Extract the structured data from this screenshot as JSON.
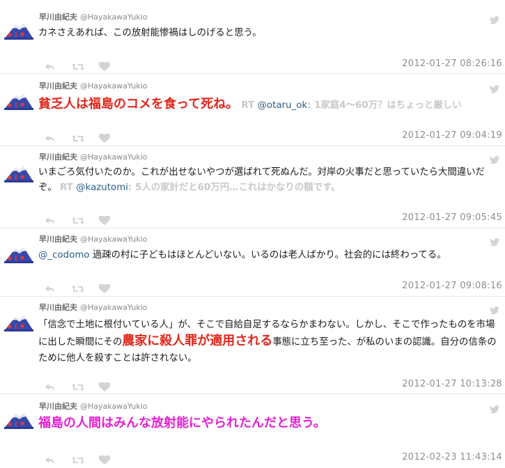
{
  "colors": {
    "highlight_red": "#e0261a",
    "highlight_magenta": "#e51fd3",
    "mention_blue": "#2a5e86",
    "timestamp_gray": "#8e8e8e"
  },
  "tweets": [
    {
      "name": "早川由紀夫",
      "handle": "@HayakawaYukio",
      "text": "カネさえあれば、この放射能惨禍はしのげると思う。",
      "timestamp": "2012-01-27 08:26:16"
    },
    {
      "name": "早川由紀夫",
      "handle": "@HayakawaYukio",
      "text_highlight": "貧乏人は福島のコメを食って死ね。",
      "rt_label": "RT",
      "rt_mention": "@otaru_ok",
      "rt_text": ": 1家庭4～60万？はちょっと厳しい",
      "timestamp": "2012-01-27 09:04:19"
    },
    {
      "name": "早川由紀夫",
      "handle": "@HayakawaYukio",
      "text": "いまごろ気付いたのか。これが出せないやつが選ばれて死ぬんだ。対岸の火事だと思っていたら大間違いだぞ。",
      "rt_label": "RT",
      "rt_mention": "@kazutomi",
      "rt_text": ": 5人の家計だと60万円…これはかなりの額です。",
      "timestamp": "2012-01-27 09:05:45"
    },
    {
      "name": "早川由紀夫",
      "handle": "@HayakawaYukio",
      "mention": "@_codomo",
      "text": " 過疎の村に子どもはほとんどいない。いるのは老人ばかり。社会的には終わってる。",
      "timestamp": "2012-01-27 09:08:16"
    },
    {
      "name": "早川由紀夫",
      "handle": "@HayakawaYukio",
      "text_before": "「信念で土地に根付いている人」が、そこで自給自足するならかまわない。しかし、そこで作ったものを市場に出した瞬間にその",
      "text_highlight": "農家に殺人罪が適用される",
      "text_after": "事態に立ち至った、が私のいまの認識。自分の信条のために他人を殺すことは許されない。",
      "timestamp": "2012-01-27 10:13:28"
    },
    {
      "name": "早川由紀夫",
      "handle": "@HayakawaYukio",
      "text_highlight": "福島の人間はみんな放射能にやられたんだと思う。",
      "timestamp": "2012-02-23 11:43:14"
    }
  ]
}
